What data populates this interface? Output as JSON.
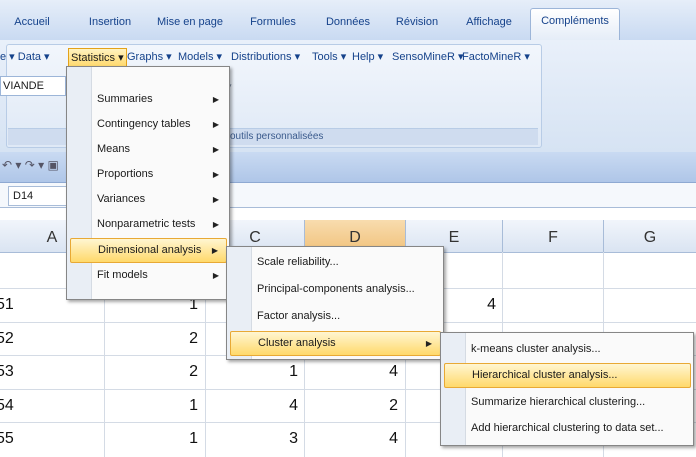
{
  "ribbon_tabs": [
    "Accueil",
    "Insertion",
    "Mise en page",
    "Formules",
    "Données",
    "Révision",
    "Affichage",
    "Compléments"
  ],
  "ribbon_menus": [
    "e ▾ Data ▾",
    "Statistics ▾",
    "Graphs ▾",
    "Models ▾",
    "Distributions ▾",
    "Tools ▾",
    "Help ▾",
    "SensoMineR ▾",
    "FactoMineR ▾"
  ],
  "combo_value": "VIANDE",
  "group_label": "outils personnalisées",
  "name_box": "D14",
  "columns": [
    "A",
    "B",
    "C",
    "D",
    "E",
    "F",
    "G"
  ],
  "rows": [
    {
      "a": "51",
      "b": "1",
      "c": "",
      "d": "",
      "e": "4"
    },
    {
      "a": "52",
      "b": "2",
      "c": "",
      "d": "",
      "e": ""
    },
    {
      "a": "53",
      "b": "2",
      "c": "1",
      "d": "4",
      "e": ""
    },
    {
      "a": "54",
      "b": "1",
      "c": "4",
      "d": "2",
      "e": ""
    },
    {
      "a": "55",
      "b": "1",
      "c": "3",
      "d": "4",
      "e": ""
    }
  ],
  "statistics_menu": [
    {
      "label": "Summaries",
      "submenu": true
    },
    {
      "label": "Contingency tables",
      "submenu": true
    },
    {
      "label": "Means",
      "submenu": true
    },
    {
      "label": "Proportions",
      "submenu": true
    },
    {
      "label": "Variances",
      "submenu": true
    },
    {
      "label": "Nonparametric tests",
      "submenu": true
    },
    {
      "label": "Dimensional analysis",
      "submenu": true
    },
    {
      "label": "Fit models",
      "submenu": true
    }
  ],
  "dimensional_menu": [
    {
      "label": "Scale reliability..."
    },
    {
      "label": "Principal-components analysis..."
    },
    {
      "label": "Factor analysis..."
    },
    {
      "label": "Cluster analysis",
      "submenu": true
    }
  ],
  "cluster_menu": [
    {
      "label": "k-means cluster analysis..."
    },
    {
      "label": "Hierarchical cluster analysis..."
    },
    {
      "label": "Summarize hierarchical clustering..."
    },
    {
      "label": "Add hierarchical clustering to data set..."
    }
  ],
  "colors": {
    "accent": "#15428b",
    "highlight": "#ffd96b",
    "ribbon": "#d6e3f3"
  }
}
